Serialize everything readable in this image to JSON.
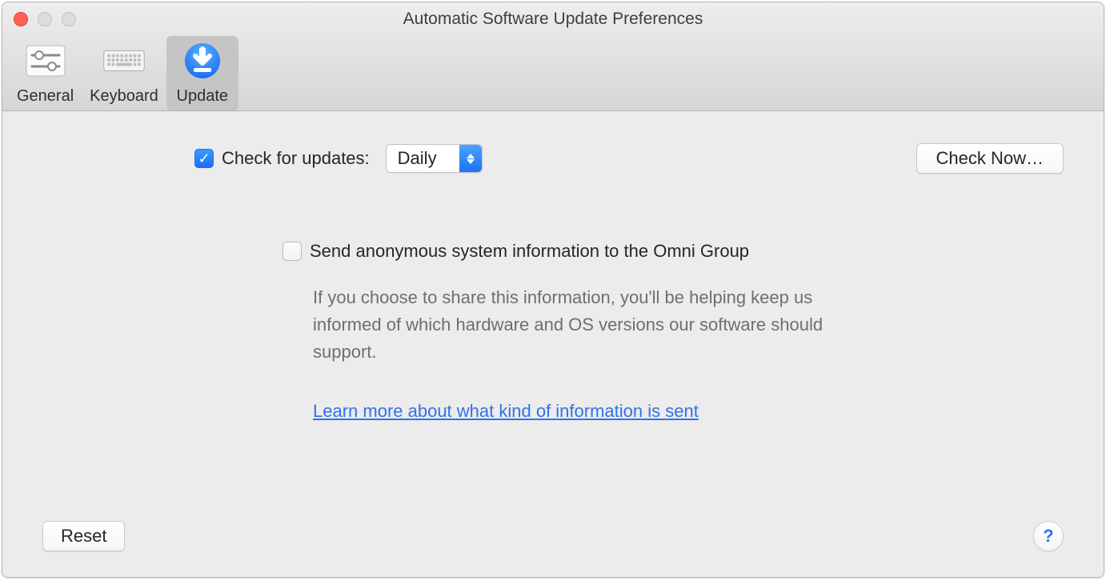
{
  "window": {
    "title": "Automatic Software Update Preferences"
  },
  "toolbar": {
    "items": [
      {
        "id": "general",
        "label": "General",
        "selected": false
      },
      {
        "id": "keyboard",
        "label": "Keyboard",
        "selected": false
      },
      {
        "id": "update",
        "label": "Update",
        "selected": true
      }
    ]
  },
  "update_pane": {
    "check_for_updates_label": "Check for updates:",
    "check_for_updates_checked": true,
    "frequency_value": "Daily",
    "check_now_label": "Check Now…",
    "send_anonymous_label": "Send anonymous system information to the Omni Group",
    "send_anonymous_checked": false,
    "send_anonymous_description": "If you choose to share this information, you'll be helping keep us informed of which hardware and OS versions our software should support.",
    "learn_more_label": "Learn more about what kind of information is sent"
  },
  "footer": {
    "reset_label": "Reset",
    "help_label": "?"
  },
  "colors": {
    "accent_blue": "#1d73f4",
    "link_blue": "#2f72ec",
    "window_bg": "#ececec",
    "toolbar_selected": "#c6c5c5"
  }
}
